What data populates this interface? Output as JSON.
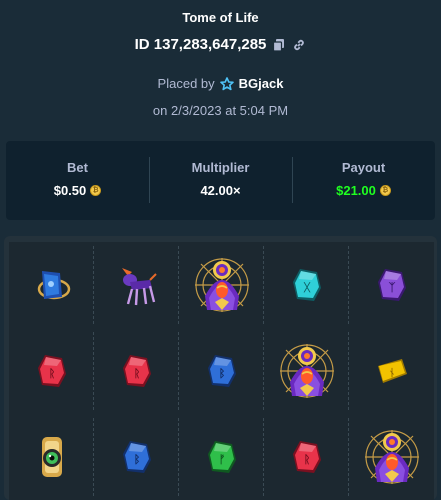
{
  "game": {
    "title": "Tome of Life",
    "id_text": "ID 137,283,647,285",
    "placed_by_prefix": "Placed by",
    "user": "BGjack",
    "date_text": "on 2/3/2023 at 5:04 PM"
  },
  "stats": {
    "bet_label": "Bet",
    "bet_value": "$0.50",
    "multiplier_label": "Multiplier",
    "multiplier_value": "42.00×",
    "payout_label": "Payout",
    "payout_value": "$21.00"
  },
  "colors": {
    "background": "#1a2c38",
    "panel": "#0f212e",
    "payout_green": "#1fff20",
    "muted_text": "#b1bad3"
  },
  "board": {
    "rows": [
      [
        "blue-tablet-symbol",
        "purple-creature-symbol",
        "eye-priestess-wild-symbol",
        "cyan-rune-symbol",
        "purple-rune-symbol"
      ],
      [
        "red-rune-symbol",
        "red-rune-symbol",
        "blue-rune-symbol",
        "eye-priestess-wild-symbol",
        "yellow-rune-symbol"
      ],
      [
        "golden-eye-amulet-symbol",
        "blue-rune-symbol",
        "green-rune-symbol",
        "red-rune-symbol",
        "eye-priestess-wild-symbol"
      ]
    ]
  }
}
